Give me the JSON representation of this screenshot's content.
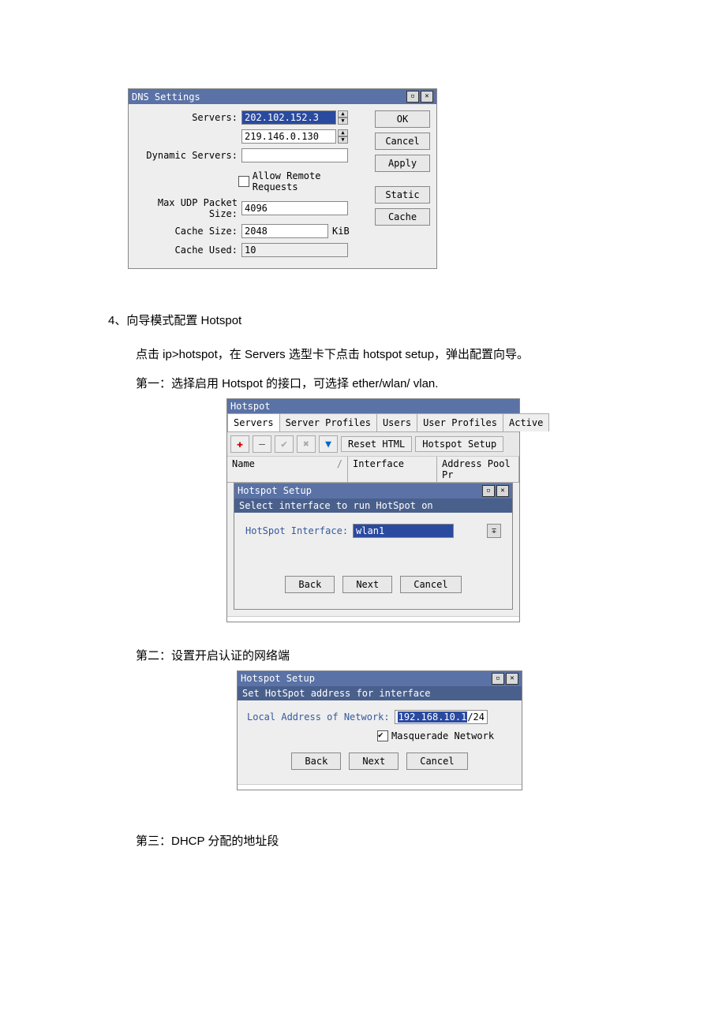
{
  "dns": {
    "title": "DNS Settings",
    "labels": {
      "servers": "Servers:",
      "dynamic": "Dynamic Servers:",
      "allow_remote": "Allow Remote Requests",
      "max_udp": "Max UDP Packet Size:",
      "cache_size": "Cache Size:",
      "cache_size_unit": "KiB",
      "cache_used": "Cache Used:"
    },
    "values": {
      "server1": "202.102.152.3",
      "server2": "219.146.0.130",
      "dynamic": "",
      "allow_remote_checked": false,
      "max_udp": "4096",
      "cache_size": "2048",
      "cache_used": "10"
    },
    "buttons": {
      "ok": "OK",
      "cancel": "Cancel",
      "apply": "Apply",
      "static": "Static",
      "cache": "Cache"
    }
  },
  "doc": {
    "sec4_num": "4、",
    "sec4_title": "向导模式配置 Hotspot",
    "p1": "点击 ip>hotspot，在 Servers 选型卡下点击 hotspot setup，弹出配置向导。",
    "p2": "第一：选择启用 Hotspot 的接口，可选择 ether/wlan/ vlan.",
    "p3": "第二：设置开启认证的网络端",
    "p4": "第三：DHCP 分配的地址段"
  },
  "hotspot": {
    "win_title": "Hotspot",
    "tabs": [
      "Servers",
      "Server Profiles",
      "Users",
      "User Profiles",
      "Active"
    ],
    "toolbar": {
      "reset_html": "Reset HTML",
      "hotspot_setup": "Hotspot Setup"
    },
    "headers": {
      "name": "Name",
      "interface": "Interface",
      "address_pool": "Address Pool",
      "pr": "Pr"
    },
    "setup1": {
      "title": "Hotspot Setup",
      "subtitle": "Select interface to run HotSpot on",
      "iface_label": "HotSpot Interface:",
      "iface_value": "wlan1",
      "back": "Back",
      "next": "Next",
      "cancel": "Cancel"
    }
  },
  "setup2": {
    "title": "Hotspot Setup",
    "subtitle": "Set HotSpot address for interface",
    "local_addr_label": "Local Address of Network:",
    "local_addr_sel": "192.168.10.1",
    "local_addr_rest": "/24",
    "masq_label": "Masquerade Network",
    "masq_checked": true,
    "back": "Back",
    "next": "Next",
    "cancel": "Cancel"
  }
}
